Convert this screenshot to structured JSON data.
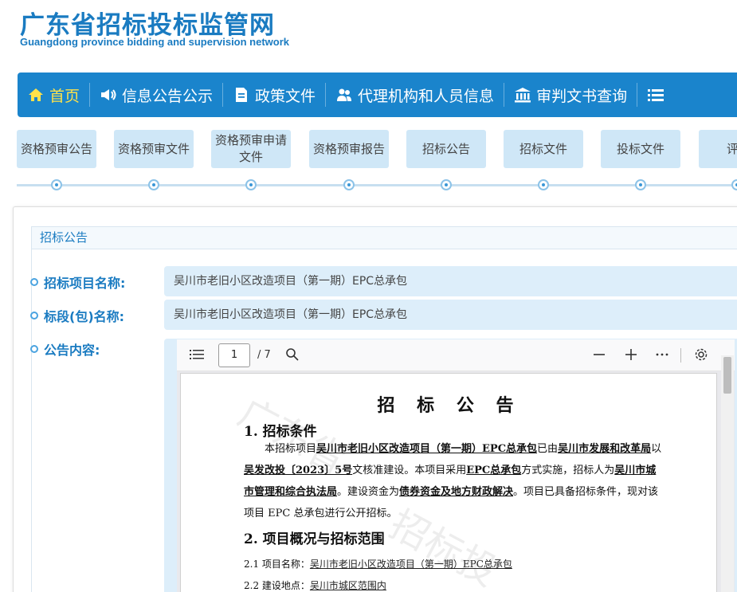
{
  "header": {
    "title_cn": "广东省招标投标监管网",
    "title_en": "Guangdong province bidding and supervision network"
  },
  "nav": {
    "items": [
      {
        "label": "首页",
        "icon": "home-icon"
      },
      {
        "label": "信息公告公示",
        "icon": "megaphone-icon"
      },
      {
        "label": "政策文件",
        "icon": "document-icon"
      },
      {
        "label": "代理机构和人员信息",
        "icon": "people-icon"
      },
      {
        "label": "审判文书查询",
        "icon": "courthouse-icon"
      }
    ],
    "more_icon": "list-icon"
  },
  "steps": [
    "资格预审公告",
    "资格预审文件",
    "资格预审申请文件",
    "资格预审报告",
    "招标公告",
    "招标文件",
    "投标文件",
    "评标"
  ],
  "panel": {
    "title": "招标公告",
    "project_label": "招标项目名称:",
    "project_value": "吴川市老旧小区改造项目（第一期）EPC总承包",
    "section_label": "标段(包)名称:",
    "section_value": "吴川市老旧小区改造项目（第一期）EPC总承包",
    "content_label": "公告内容:"
  },
  "pdf": {
    "page_current": "1",
    "page_total": "/ 7",
    "doc_title": "招 标 公 告",
    "s1_title": "1.  招标条件",
    "p1": {
      "a": "本招标项目",
      "project": "吴川市老旧小区改造项目（第一期）EPC总承包",
      "b": "已由",
      "approver": "吴川市发展和改革局",
      "c": "以",
      "doc_no": "吴发改投〔2023〕5号",
      "d": "文核准建设。本项目采用",
      "mode": "EPC总承包",
      "e": "方式实施，招标人为",
      "tenderer": "吴川市城市管理和综合执法局",
      "f": "。建设资金为",
      "fund": "债券资金及地方财政解决",
      "g": "。项目已具备招标条件，现对该项目 EPC 总承包进行公开招标。"
    },
    "s2_title": "2.  项目概况与招标范围",
    "item1_label": "2.1  项目名称：",
    "item1_value": "吴川市老旧小区改造项目（第一期）EPC总承包",
    "item2_label": "2.2  建设地点：",
    "item2_value": "吴川市城区范围内"
  }
}
